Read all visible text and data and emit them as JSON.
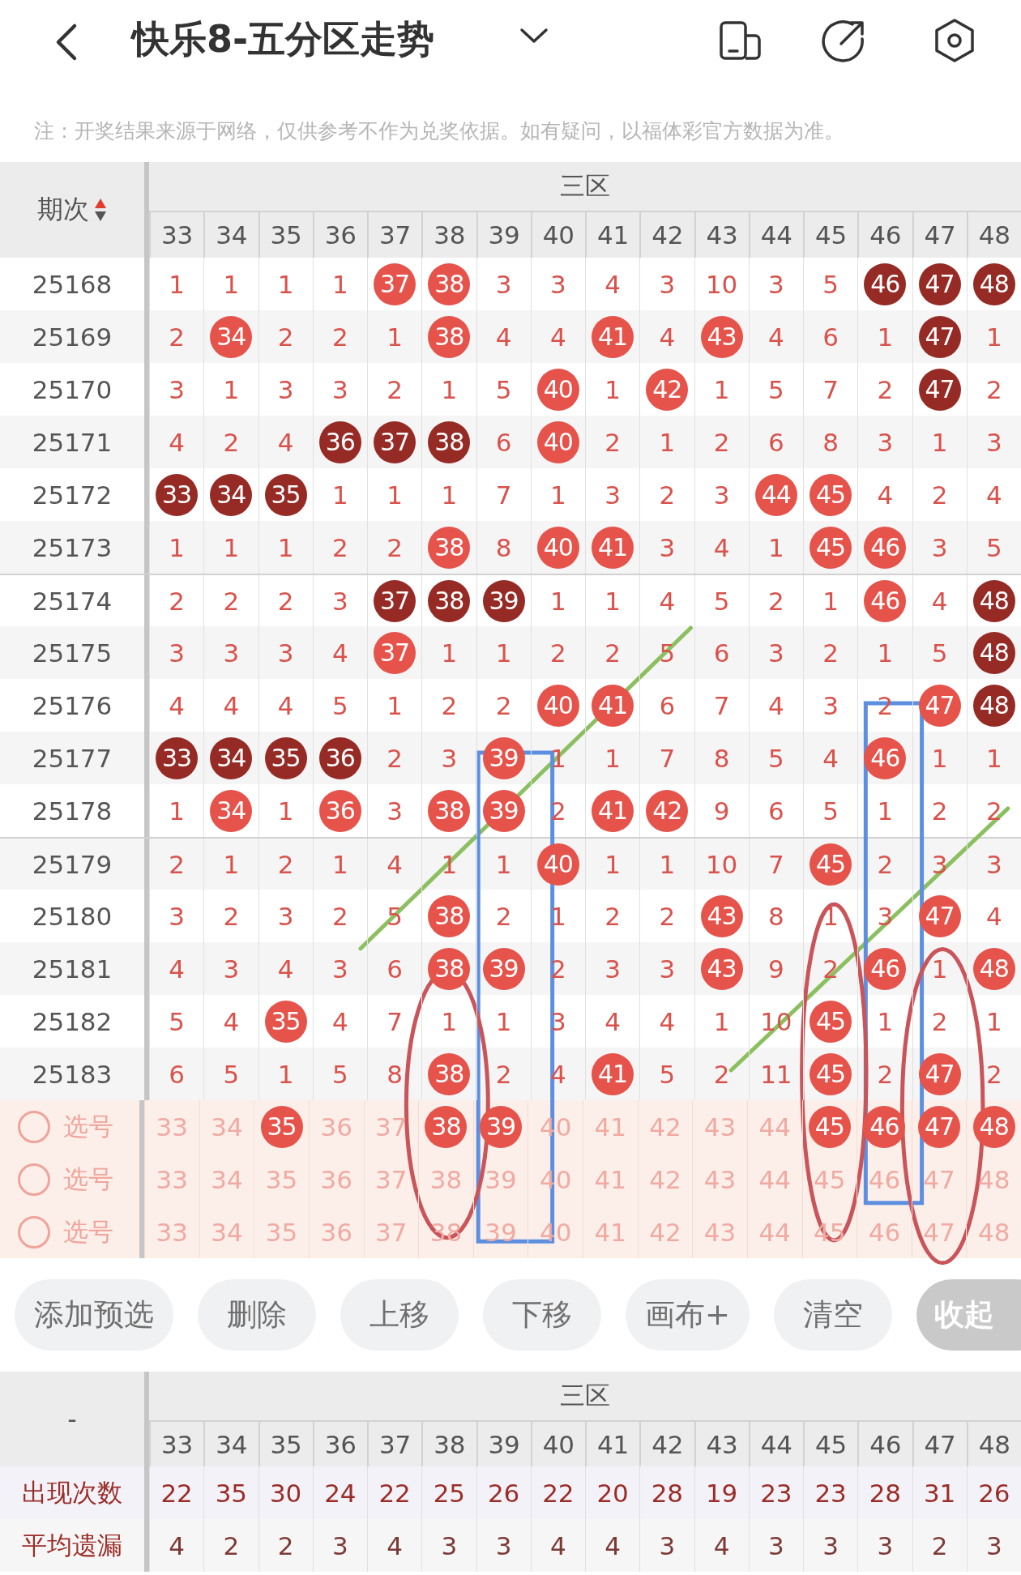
{
  "header": {
    "title": "快乐8-五分区走势"
  },
  "note": "注：开奖结果来源于网络，仅供参考不作为兑奖依据。如有疑问，以福体彩官方数据为准。",
  "trend_table": {
    "corner": "期次",
    "zone": "三区",
    "columns": [
      "33",
      "34",
      "35",
      "36",
      "37",
      "38",
      "39",
      "40",
      "41",
      "42",
      "43",
      "44",
      "45",
      "46",
      "47",
      "48"
    ],
    "rows": [
      {
        "period": "25168",
        "cells": [
          {
            "text": "1",
            "kind": "miss"
          },
          {
            "text": "1",
            "kind": "miss"
          },
          {
            "text": "1",
            "kind": "miss"
          },
          {
            "text": "1",
            "kind": "miss"
          },
          {
            "text": "37",
            "kind": "ball"
          },
          {
            "text": "38",
            "kind": "ball"
          },
          {
            "text": "3",
            "kind": "miss"
          },
          {
            "text": "3",
            "kind": "miss"
          },
          {
            "text": "4",
            "kind": "miss"
          },
          {
            "text": "3",
            "kind": "miss"
          },
          {
            "text": "10",
            "kind": "miss"
          },
          {
            "text": "3",
            "kind": "miss"
          },
          {
            "text": "5",
            "kind": "miss"
          },
          {
            "text": "46",
            "kind": "dark_ball"
          },
          {
            "text": "47",
            "kind": "dark_ball"
          },
          {
            "text": "48",
            "kind": "dark_ball"
          }
        ]
      },
      {
        "period": "25169",
        "cells": [
          {
            "text": "2",
            "kind": "miss"
          },
          {
            "text": "34",
            "kind": "ball"
          },
          {
            "text": "2",
            "kind": "miss"
          },
          {
            "text": "2",
            "kind": "miss"
          },
          {
            "text": "1",
            "kind": "miss"
          },
          {
            "text": "38",
            "kind": "ball"
          },
          {
            "text": "4",
            "kind": "miss"
          },
          {
            "text": "4",
            "kind": "miss"
          },
          {
            "text": "41",
            "kind": "ball"
          },
          {
            "text": "4",
            "kind": "miss"
          },
          {
            "text": "43",
            "kind": "ball"
          },
          {
            "text": "4",
            "kind": "miss"
          },
          {
            "text": "6",
            "kind": "miss"
          },
          {
            "text": "1",
            "kind": "miss"
          },
          {
            "text": "47",
            "kind": "dark_ball"
          },
          {
            "text": "1",
            "kind": "miss"
          }
        ]
      },
      {
        "period": "25170",
        "cells": [
          {
            "text": "3",
            "kind": "miss"
          },
          {
            "text": "1",
            "kind": "miss"
          },
          {
            "text": "3",
            "kind": "miss"
          },
          {
            "text": "3",
            "kind": "miss"
          },
          {
            "text": "2",
            "kind": "miss"
          },
          {
            "text": "1",
            "kind": "miss"
          },
          {
            "text": "5",
            "kind": "miss"
          },
          {
            "text": "40",
            "kind": "ball"
          },
          {
            "text": "1",
            "kind": "miss"
          },
          {
            "text": "42",
            "kind": "ball"
          },
          {
            "text": "1",
            "kind": "miss"
          },
          {
            "text": "5",
            "kind": "miss"
          },
          {
            "text": "7",
            "kind": "miss"
          },
          {
            "text": "2",
            "kind": "miss"
          },
          {
            "text": "47",
            "kind": "dark_ball"
          },
          {
            "text": "2",
            "kind": "miss"
          }
        ]
      },
      {
        "period": "25171",
        "cells": [
          {
            "text": "4",
            "kind": "miss"
          },
          {
            "text": "2",
            "kind": "miss"
          },
          {
            "text": "4",
            "kind": "miss"
          },
          {
            "text": "36",
            "kind": "dark_ball"
          },
          {
            "text": "37",
            "kind": "dark_ball"
          },
          {
            "text": "38",
            "kind": "dark_ball"
          },
          {
            "text": "6",
            "kind": "miss"
          },
          {
            "text": "40",
            "kind": "ball"
          },
          {
            "text": "2",
            "kind": "miss"
          },
          {
            "text": "1",
            "kind": "miss"
          },
          {
            "text": "2",
            "kind": "miss"
          },
          {
            "text": "6",
            "kind": "miss"
          },
          {
            "text": "8",
            "kind": "miss"
          },
          {
            "text": "3",
            "kind": "miss"
          },
          {
            "text": "1",
            "kind": "miss"
          },
          {
            "text": "3",
            "kind": "miss"
          }
        ]
      },
      {
        "period": "25172",
        "cells": [
          {
            "text": "33",
            "kind": "dark_ball"
          },
          {
            "text": "34",
            "kind": "dark_ball"
          },
          {
            "text": "35",
            "kind": "dark_ball"
          },
          {
            "text": "1",
            "kind": "miss"
          },
          {
            "text": "1",
            "kind": "miss"
          },
          {
            "text": "1",
            "kind": "miss"
          },
          {
            "text": "7",
            "kind": "miss"
          },
          {
            "text": "1",
            "kind": "miss"
          },
          {
            "text": "3",
            "kind": "miss"
          },
          {
            "text": "2",
            "kind": "miss"
          },
          {
            "text": "3",
            "kind": "miss"
          },
          {
            "text": "44",
            "kind": "ball"
          },
          {
            "text": "45",
            "kind": "ball"
          },
          {
            "text": "4",
            "kind": "miss"
          },
          {
            "text": "2",
            "kind": "miss"
          },
          {
            "text": "4",
            "kind": "miss"
          }
        ]
      },
      {
        "period": "25173",
        "cells": [
          {
            "text": "1",
            "kind": "miss"
          },
          {
            "text": "1",
            "kind": "miss"
          },
          {
            "text": "1",
            "kind": "miss"
          },
          {
            "text": "2",
            "kind": "miss"
          },
          {
            "text": "2",
            "kind": "miss"
          },
          {
            "text": "38",
            "kind": "ball"
          },
          {
            "text": "8",
            "kind": "miss"
          },
          {
            "text": "40",
            "kind": "ball"
          },
          {
            "text": "41",
            "kind": "ball"
          },
          {
            "text": "3",
            "kind": "miss"
          },
          {
            "text": "4",
            "kind": "miss"
          },
          {
            "text": "1",
            "kind": "miss"
          },
          {
            "text": "45",
            "kind": "ball"
          },
          {
            "text": "46",
            "kind": "ball"
          },
          {
            "text": "3",
            "kind": "miss"
          },
          {
            "text": "5",
            "kind": "miss"
          }
        ]
      },
      {
        "period": "25174",
        "cells": [
          {
            "text": "2",
            "kind": "miss"
          },
          {
            "text": "2",
            "kind": "miss"
          },
          {
            "text": "2",
            "kind": "miss"
          },
          {
            "text": "3",
            "kind": "miss"
          },
          {
            "text": "37",
            "kind": "dark_ball"
          },
          {
            "text": "38",
            "kind": "dark_ball"
          },
          {
            "text": "39",
            "kind": "dark_ball"
          },
          {
            "text": "1",
            "kind": "miss"
          },
          {
            "text": "1",
            "kind": "miss"
          },
          {
            "text": "4",
            "kind": "miss"
          },
          {
            "text": "5",
            "kind": "miss"
          },
          {
            "text": "2",
            "kind": "miss"
          },
          {
            "text": "1",
            "kind": "miss"
          },
          {
            "text": "46",
            "kind": "ball"
          },
          {
            "text": "4",
            "kind": "miss"
          },
          {
            "text": "48",
            "kind": "dark_ball"
          }
        ]
      },
      {
        "period": "25175",
        "cells": [
          {
            "text": "3",
            "kind": "miss"
          },
          {
            "text": "3",
            "kind": "miss"
          },
          {
            "text": "3",
            "kind": "miss"
          },
          {
            "text": "4",
            "kind": "miss"
          },
          {
            "text": "37",
            "kind": "ball"
          },
          {
            "text": "1",
            "kind": "miss"
          },
          {
            "text": "1",
            "kind": "miss"
          },
          {
            "text": "2",
            "kind": "miss"
          },
          {
            "text": "2",
            "kind": "miss"
          },
          {
            "text": "5",
            "kind": "miss"
          },
          {
            "text": "6",
            "kind": "miss"
          },
          {
            "text": "3",
            "kind": "miss"
          },
          {
            "text": "2",
            "kind": "miss"
          },
          {
            "text": "1",
            "kind": "miss"
          },
          {
            "text": "5",
            "kind": "miss"
          },
          {
            "text": "48",
            "kind": "dark_ball"
          }
        ]
      },
      {
        "period": "25176",
        "cells": [
          {
            "text": "4",
            "kind": "miss"
          },
          {
            "text": "4",
            "kind": "miss"
          },
          {
            "text": "4",
            "kind": "miss"
          },
          {
            "text": "5",
            "kind": "miss"
          },
          {
            "text": "1",
            "kind": "miss"
          },
          {
            "text": "2",
            "kind": "miss"
          },
          {
            "text": "2",
            "kind": "miss"
          },
          {
            "text": "40",
            "kind": "ball"
          },
          {
            "text": "41",
            "kind": "ball"
          },
          {
            "text": "6",
            "kind": "miss"
          },
          {
            "text": "7",
            "kind": "miss"
          },
          {
            "text": "4",
            "kind": "miss"
          },
          {
            "text": "3",
            "kind": "miss"
          },
          {
            "text": "2",
            "kind": "miss"
          },
          {
            "text": "47",
            "kind": "ball"
          },
          {
            "text": "48",
            "kind": "dark_ball"
          }
        ]
      },
      {
        "period": "25177",
        "cells": [
          {
            "text": "33",
            "kind": "dark_ball"
          },
          {
            "text": "34",
            "kind": "dark_ball"
          },
          {
            "text": "35",
            "kind": "dark_ball"
          },
          {
            "text": "36",
            "kind": "dark_ball"
          },
          {
            "text": "2",
            "kind": "miss"
          },
          {
            "text": "3",
            "kind": "miss"
          },
          {
            "text": "39",
            "kind": "ball"
          },
          {
            "text": "1",
            "kind": "miss"
          },
          {
            "text": "1",
            "kind": "miss"
          },
          {
            "text": "7",
            "kind": "miss"
          },
          {
            "text": "8",
            "kind": "miss"
          },
          {
            "text": "5",
            "kind": "miss"
          },
          {
            "text": "4",
            "kind": "miss"
          },
          {
            "text": "46",
            "kind": "ball"
          },
          {
            "text": "1",
            "kind": "miss"
          },
          {
            "text": "1",
            "kind": "miss"
          }
        ]
      },
      {
        "period": "25178",
        "cells": [
          {
            "text": "1",
            "kind": "miss"
          },
          {
            "text": "34",
            "kind": "ball"
          },
          {
            "text": "1",
            "kind": "miss"
          },
          {
            "text": "36",
            "kind": "ball"
          },
          {
            "text": "3",
            "kind": "miss"
          },
          {
            "text": "38",
            "kind": "ball"
          },
          {
            "text": "39",
            "kind": "ball"
          },
          {
            "text": "2",
            "kind": "miss"
          },
          {
            "text": "41",
            "kind": "ball"
          },
          {
            "text": "42",
            "kind": "ball"
          },
          {
            "text": "9",
            "kind": "miss"
          },
          {
            "text": "6",
            "kind": "miss"
          },
          {
            "text": "5",
            "kind": "miss"
          },
          {
            "text": "1",
            "kind": "miss"
          },
          {
            "text": "2",
            "kind": "miss"
          },
          {
            "text": "2",
            "kind": "miss"
          }
        ]
      },
      {
        "period": "25179",
        "cells": [
          {
            "text": "2",
            "kind": "miss"
          },
          {
            "text": "1",
            "kind": "miss"
          },
          {
            "text": "2",
            "kind": "miss"
          },
          {
            "text": "1",
            "kind": "miss"
          },
          {
            "text": "4",
            "kind": "miss"
          },
          {
            "text": "1",
            "kind": "miss"
          },
          {
            "text": "1",
            "kind": "miss"
          },
          {
            "text": "40",
            "kind": "ball"
          },
          {
            "text": "1",
            "kind": "miss"
          },
          {
            "text": "1",
            "kind": "miss"
          },
          {
            "text": "10",
            "kind": "miss"
          },
          {
            "text": "7",
            "kind": "miss"
          },
          {
            "text": "45",
            "kind": "ball"
          },
          {
            "text": "2",
            "kind": "miss"
          },
          {
            "text": "3",
            "kind": "miss"
          },
          {
            "text": "3",
            "kind": "miss"
          }
        ]
      },
      {
        "period": "25180",
        "cells": [
          {
            "text": "3",
            "kind": "miss"
          },
          {
            "text": "2",
            "kind": "miss"
          },
          {
            "text": "3",
            "kind": "miss"
          },
          {
            "text": "2",
            "kind": "miss"
          },
          {
            "text": "5",
            "kind": "miss"
          },
          {
            "text": "38",
            "kind": "ball"
          },
          {
            "text": "2",
            "kind": "miss"
          },
          {
            "text": "1",
            "kind": "miss"
          },
          {
            "text": "2",
            "kind": "miss"
          },
          {
            "text": "2",
            "kind": "miss"
          },
          {
            "text": "43",
            "kind": "ball"
          },
          {
            "text": "8",
            "kind": "miss"
          },
          {
            "text": "1",
            "kind": "miss"
          },
          {
            "text": "3",
            "kind": "miss"
          },
          {
            "text": "47",
            "kind": "ball"
          },
          {
            "text": "4",
            "kind": "miss"
          }
        ]
      },
      {
        "period": "25181",
        "cells": [
          {
            "text": "4",
            "kind": "miss"
          },
          {
            "text": "3",
            "kind": "miss"
          },
          {
            "text": "4",
            "kind": "miss"
          },
          {
            "text": "3",
            "kind": "miss"
          },
          {
            "text": "6",
            "kind": "miss"
          },
          {
            "text": "38",
            "kind": "ball"
          },
          {
            "text": "39",
            "kind": "ball"
          },
          {
            "text": "2",
            "kind": "miss"
          },
          {
            "text": "3",
            "kind": "miss"
          },
          {
            "text": "3",
            "kind": "miss"
          },
          {
            "text": "43",
            "kind": "ball"
          },
          {
            "text": "9",
            "kind": "miss"
          },
          {
            "text": "2",
            "kind": "miss"
          },
          {
            "text": "46",
            "kind": "ball"
          },
          {
            "text": "1",
            "kind": "miss"
          },
          {
            "text": "48",
            "kind": "ball"
          }
        ]
      },
      {
        "period": "25182",
        "cells": [
          {
            "text": "5",
            "kind": "miss"
          },
          {
            "text": "4",
            "kind": "miss"
          },
          {
            "text": "35",
            "kind": "ball"
          },
          {
            "text": "4",
            "kind": "miss"
          },
          {
            "text": "7",
            "kind": "miss"
          },
          {
            "text": "1",
            "kind": "miss"
          },
          {
            "text": "1",
            "kind": "miss"
          },
          {
            "text": "3",
            "kind": "miss"
          },
          {
            "text": "4",
            "kind": "miss"
          },
          {
            "text": "4",
            "kind": "miss"
          },
          {
            "text": "1",
            "kind": "miss"
          },
          {
            "text": "10",
            "kind": "miss"
          },
          {
            "text": "45",
            "kind": "ball"
          },
          {
            "text": "1",
            "kind": "miss"
          },
          {
            "text": "2",
            "kind": "miss"
          },
          {
            "text": "1",
            "kind": "miss"
          }
        ]
      },
      {
        "period": "25183",
        "cells": [
          {
            "text": "6",
            "kind": "miss"
          },
          {
            "text": "5",
            "kind": "miss"
          },
          {
            "text": "1",
            "kind": "miss"
          },
          {
            "text": "5",
            "kind": "miss"
          },
          {
            "text": "8",
            "kind": "miss"
          },
          {
            "text": "38",
            "kind": "ball"
          },
          {
            "text": "2",
            "kind": "miss"
          },
          {
            "text": "4",
            "kind": "miss"
          },
          {
            "text": "41",
            "kind": "ball"
          },
          {
            "text": "5",
            "kind": "miss"
          },
          {
            "text": "2",
            "kind": "miss"
          },
          {
            "text": "11",
            "kind": "miss"
          },
          {
            "text": "45",
            "kind": "ball"
          },
          {
            "text": "2",
            "kind": "miss"
          },
          {
            "text": "47",
            "kind": "ball"
          },
          {
            "text": "2",
            "kind": "miss"
          }
        ]
      }
    ]
  },
  "pick_rows": [
    {
      "label": "选号",
      "checked": false,
      "numbers": [
        {
          "text": "33",
          "selected": false
        },
        {
          "text": "34",
          "selected": false
        },
        {
          "text": "35",
          "selected": true
        },
        {
          "text": "36",
          "selected": false
        },
        {
          "text": "37",
          "selected": false
        },
        {
          "text": "38",
          "selected": true
        },
        {
          "text": "39",
          "selected": true
        },
        {
          "text": "40",
          "selected": false
        },
        {
          "text": "41",
          "selected": false
        },
        {
          "text": "42",
          "selected": false
        },
        {
          "text": "43",
          "selected": false
        },
        {
          "text": "44",
          "selected": false
        },
        {
          "text": "45",
          "selected": true
        },
        {
          "text": "46",
          "selected": true
        },
        {
          "text": "47",
          "selected": true
        },
        {
          "text": "48",
          "selected": true
        }
      ]
    },
    {
      "label": "选号",
      "checked": false,
      "numbers": [
        {
          "text": "33",
          "selected": false
        },
        {
          "text": "34",
          "selected": false
        },
        {
          "text": "35",
          "selected": false
        },
        {
          "text": "36",
          "selected": false
        },
        {
          "text": "37",
          "selected": false
        },
        {
          "text": "38",
          "selected": false
        },
        {
          "text": "39",
          "selected": false
        },
        {
          "text": "40",
          "selected": false
        },
        {
          "text": "41",
          "selected": false
        },
        {
          "text": "42",
          "selected": false
        },
        {
          "text": "43",
          "selected": false
        },
        {
          "text": "44",
          "selected": false
        },
        {
          "text": "45",
          "selected": false
        },
        {
          "text": "46",
          "selected": false
        },
        {
          "text": "47",
          "selected": false
        },
        {
          "text": "48",
          "selected": false
        }
      ]
    },
    {
      "label": "选号",
      "checked": false,
      "numbers": [
        {
          "text": "33",
          "selected": false
        },
        {
          "text": "34",
          "selected": false
        },
        {
          "text": "35",
          "selected": false
        },
        {
          "text": "36",
          "selected": false
        },
        {
          "text": "37",
          "selected": false
        },
        {
          "text": "38",
          "selected": false
        },
        {
          "text": "39",
          "selected": false
        },
        {
          "text": "40",
          "selected": false
        },
        {
          "text": "41",
          "selected": false
        },
        {
          "text": "42",
          "selected": false
        },
        {
          "text": "43",
          "selected": false
        },
        {
          "text": "44",
          "selected": false
        },
        {
          "text": "45",
          "selected": false
        },
        {
          "text": "46",
          "selected": false
        },
        {
          "text": "47",
          "selected": false
        },
        {
          "text": "48",
          "selected": false
        }
      ]
    }
  ],
  "buttons": [
    {
      "label": "添加预选",
      "selected": false
    },
    {
      "label": "删除",
      "selected": false
    },
    {
      "label": "上移",
      "selected": false
    },
    {
      "label": "下移",
      "selected": false
    },
    {
      "label": "画布+",
      "selected": false
    },
    {
      "label": "清空",
      "selected": false
    },
    {
      "label": "收起",
      "selected": true
    }
  ],
  "stats_table": {
    "corner": "-",
    "zone": "三区",
    "columns": [
      "33",
      "34",
      "35",
      "36",
      "37",
      "38",
      "39",
      "40",
      "41",
      "42",
      "43",
      "44",
      "45",
      "46",
      "47",
      "48"
    ],
    "rows": [
      {
        "label": "出现次数",
        "values": [
          "22",
          "35",
          "30",
          "24",
          "22",
          "25",
          "26",
          "22",
          "20",
          "28",
          "19",
          "23",
          "23",
          "28",
          "31",
          "26"
        ]
      },
      {
        "label": "平均遗漏",
        "values": [
          "4",
          "2",
          "2",
          "3",
          "4",
          "3",
          "3",
          "4",
          "4",
          "3",
          "4",
          "3",
          "3",
          "3",
          "2",
          "3"
        ]
      }
    ]
  }
}
